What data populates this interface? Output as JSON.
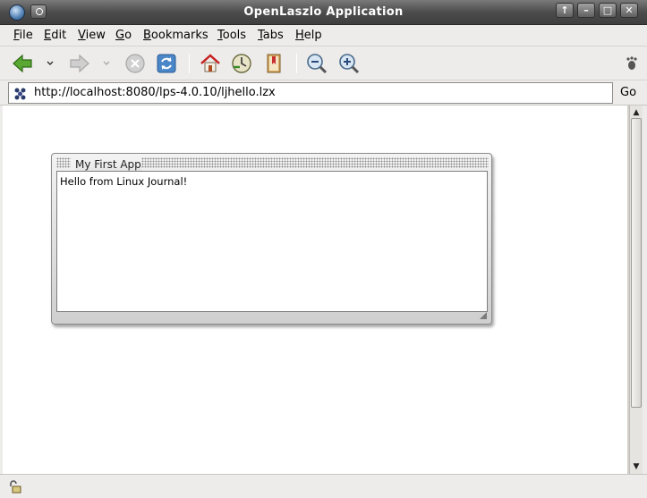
{
  "window": {
    "title": "OpenLaszlo Application",
    "buttons": {
      "up": "↑",
      "minimize": "–",
      "maximize": "□",
      "close": "✕"
    }
  },
  "menubar": {
    "items": [
      {
        "key": "F",
        "rest": "ile"
      },
      {
        "key": "E",
        "rest": "dit"
      },
      {
        "key": "V",
        "rest": "iew"
      },
      {
        "key": "G",
        "rest": "o"
      },
      {
        "key": "B",
        "rest": "ookmarks"
      },
      {
        "key": "T",
        "rest": "ools"
      },
      {
        "key": "T",
        "rest": "abs"
      },
      {
        "key": "H",
        "rest": "elp"
      }
    ]
  },
  "toolbar": {
    "icons": [
      "back-icon",
      "forward-icon",
      "stop-icon",
      "reload-icon",
      "home-icon",
      "history-icon",
      "bookmarks-icon",
      "zoom-out-icon",
      "zoom-in-icon",
      "throbber-icon"
    ]
  },
  "location": {
    "url": "http://localhost:8080/lps-4.0.10/ljhello.lzx",
    "go_label": "Go"
  },
  "app": {
    "window_title": "My First App",
    "message": "Hello from Linux Journal!"
  },
  "colors": {
    "titlebar": "#4c4c4c",
    "back_arrow": "#4a9a2a",
    "home_roof": "#c82020"
  }
}
